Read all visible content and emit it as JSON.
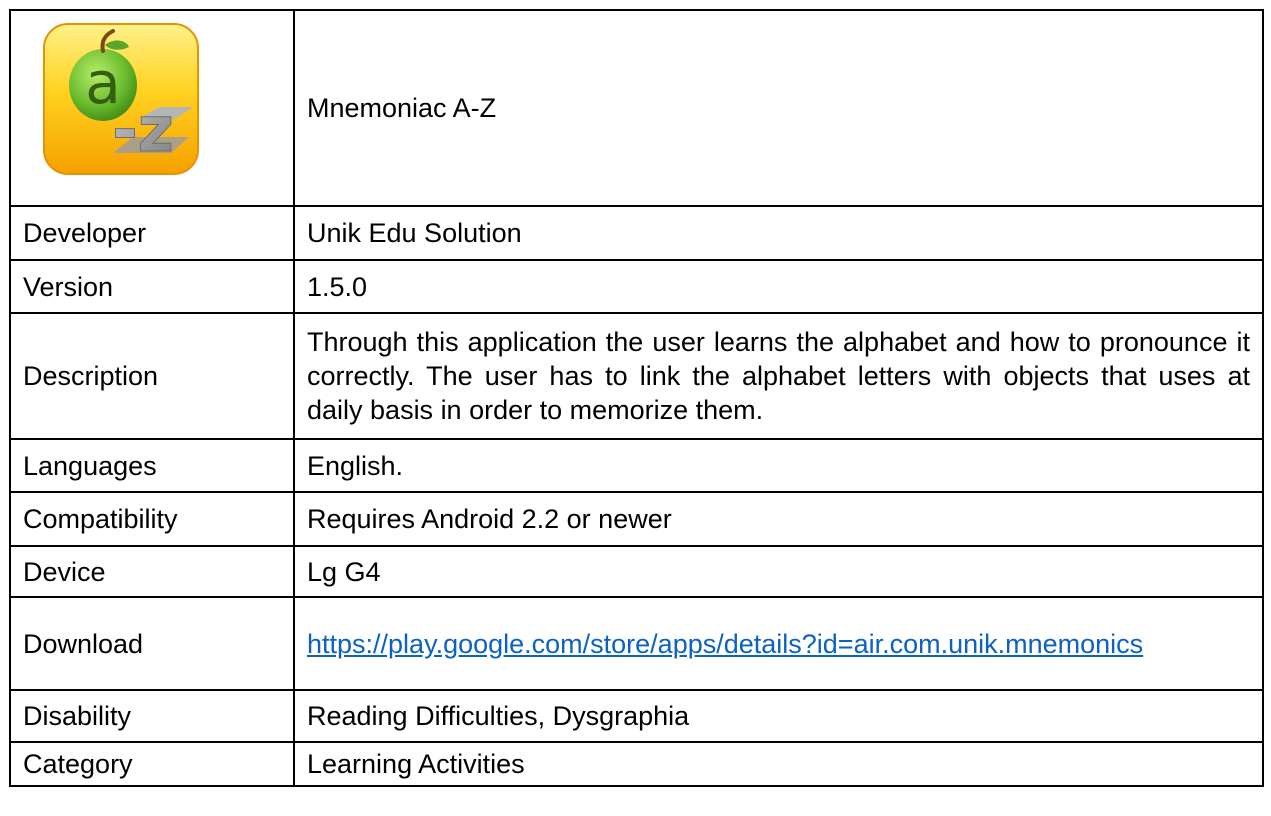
{
  "app": {
    "name": "Mnemoniac A-Z",
    "icon": {
      "name": "mnemoniac-a-z-app-icon",
      "letters": [
        "a",
        "-z"
      ],
      "colors": {
        "background_top": "#ffe066",
        "background_bottom": "#f5a300",
        "apple": "#6cbf2f",
        "letter_a": "#355e10",
        "letter_z": "#8f8f8f"
      }
    }
  },
  "rows": [
    {
      "label": "Developer",
      "value": "Unik Edu Solution"
    },
    {
      "label": "Version",
      "value": "1.5.0"
    },
    {
      "label": "Description",
      "value": "Through this application the user learns the alphabet and how to pronounce it correctly. The user has to link the alphabet letters with objects that uses at daily basis in order to memorize them."
    },
    {
      "label": "Languages",
      "value": "English."
    },
    {
      "label": "Compatibility",
      "value": "Requires Android 2.2 or newer"
    },
    {
      "label": "Device",
      "value": "Lg G4"
    },
    {
      "label": "Download",
      "value": "https://play.google.com/store/apps/details?id=air.com.unik.mnemonics"
    },
    {
      "label": "Disability",
      "value": "Reading Difficulties, Dysgraphia"
    },
    {
      "label": "Category",
      "value": "Learning Activities"
    }
  ],
  "colors": {
    "border": "#000000",
    "link": "#0b62c4"
  }
}
